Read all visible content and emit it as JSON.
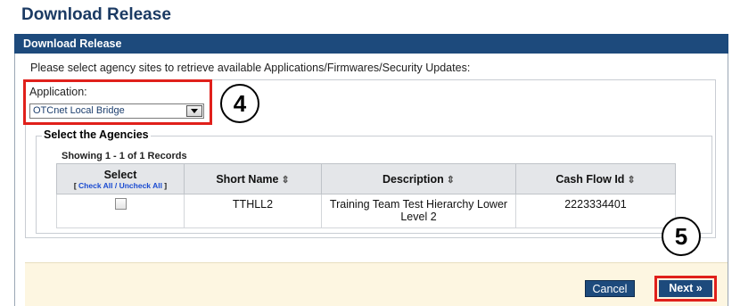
{
  "page": {
    "title": "Download Release"
  },
  "section": {
    "header": "Download Release"
  },
  "instructions": "Please select agency sites to retrieve available Applications/Firmwares/Security Updates:",
  "application": {
    "label": "Application:",
    "selected": "OTCnet Local Bridge"
  },
  "agencies": {
    "legend": "Select the Agencies",
    "records": "Showing 1 - 1 of 1 Records",
    "columns": {
      "select": "Select",
      "check_all": "Check All",
      "separator": "/",
      "uncheck_all": "Uncheck All",
      "short_name": "Short Name",
      "description": "Description",
      "cash_flow_id": "Cash Flow Id"
    },
    "sort_glyph": "⇕",
    "rows": [
      {
        "short_name": "TTHLL2",
        "description": "Training Team Test Hierarchy Lower Level 2",
        "cash_flow_id": "2223334401",
        "checked": false
      }
    ]
  },
  "buttons": {
    "cancel": "Cancel",
    "next": "Next »"
  },
  "callouts": {
    "step4": "4",
    "step5": "5"
  },
  "colors": {
    "header": "#1d4a7c",
    "title": "#1b3a63",
    "callout": "#e0201b",
    "footer": "#fdf6e1"
  }
}
